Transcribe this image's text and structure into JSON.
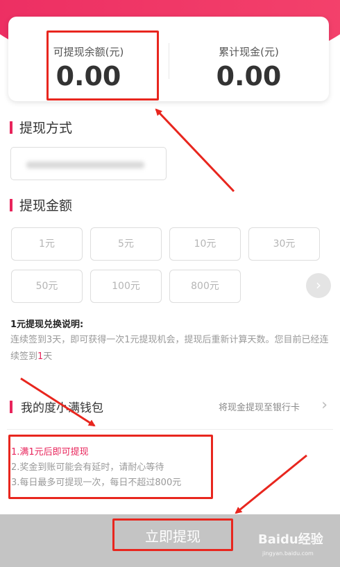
{
  "balance_card": {
    "withdrawable_label": "可提现余额(元)",
    "withdrawable_value": "0.00",
    "cumulative_label": "累计现金(元)",
    "cumulative_value": "0.00"
  },
  "method_section": {
    "title": "提现方式"
  },
  "amount_section": {
    "title": "提现金额",
    "options": [
      "1元",
      "5元",
      "10元",
      "30元",
      "50元",
      "100元",
      "800元"
    ]
  },
  "description": {
    "title": "1元提现兑换说明:",
    "text_before": "连续签到3天，即可获得一次1元提现机会，提现后重新计算天数。您目前已经连续签到",
    "highlight": "1",
    "text_after": "天"
  },
  "wallet": {
    "title": "我的度小满钱包",
    "subtitle": "将现金提现至银行卡"
  },
  "notes": [
    "1.满1元后即可提现",
    "2.奖金到账可能会有延时，请耐心等待",
    "3.每日最多可提现一次，每日不超过800元"
  ],
  "submit_button": {
    "label": "立即提现"
  },
  "watermark": {
    "brand": "Baidu经验",
    "url": "jingyan.baidu.com"
  },
  "colors": {
    "accent": "#e8245b",
    "annotation": "#e8261e"
  },
  "icons": {
    "next": "chevron-right-icon"
  }
}
